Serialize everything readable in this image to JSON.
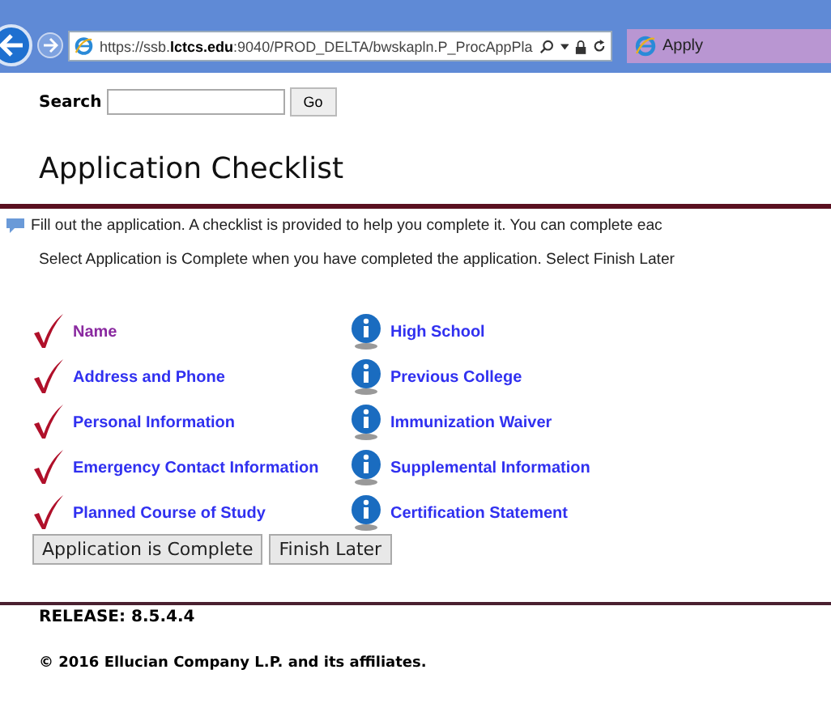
{
  "browser": {
    "address": "https://ssb.**lctcs.edu**:9040/PROD_DELTA/bwskapln.P_ProcAppPla",
    "tab_title": "Apply"
  },
  "search": {
    "label": "Search",
    "button": "Go"
  },
  "title": "Application Checklist",
  "info_message": "Fill out the application. A checklist is provided to help you complete it. You can complete eac",
  "instruction": "Select Application is Complete when you have completed the application. Select Finish Later",
  "checklist": [
    {
      "left": {
        "label": "Name",
        "completed": true,
        "visited": true
      },
      "right": {
        "label": "High School",
        "completed": false,
        "visited": false
      }
    },
    {
      "left": {
        "label": "Address and Phone",
        "completed": true,
        "visited": false
      },
      "right": {
        "label": "Previous College",
        "completed": false,
        "visited": false
      }
    },
    {
      "left": {
        "label": "Personal Information",
        "completed": true,
        "visited": false
      },
      "right": {
        "label": "Immunization Waiver",
        "completed": false,
        "visited": false
      }
    },
    {
      "left": {
        "label": "Emergency Contact Information",
        "completed": true,
        "visited": false
      },
      "right": {
        "label": "Supplemental Information",
        "completed": false,
        "visited": false
      }
    },
    {
      "left": {
        "label": "Planned Course of Study",
        "completed": true,
        "visited": false
      },
      "right": {
        "label": "Certification Statement",
        "completed": false,
        "visited": false
      }
    }
  ],
  "buttons": [
    "Application is Complete",
    "Finish Later"
  ],
  "release": "RELEASE: 8.5.4.4",
  "copyright": "© 2016 Ellucian Company L.P. and its affiliates."
}
